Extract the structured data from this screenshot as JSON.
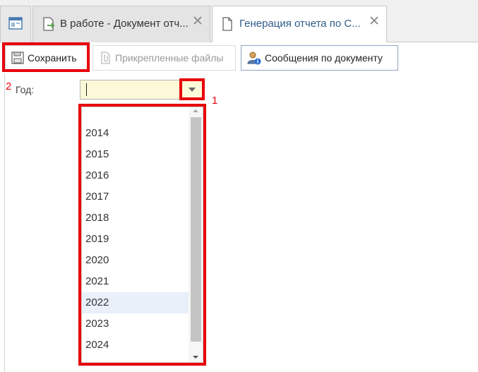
{
  "tabs": [
    {
      "label": "В работе - Документ отч...",
      "icon": "document-arrow-icon",
      "active": false
    },
    {
      "label": "Генерация отчета по С...",
      "icon": "document-icon",
      "active": true
    }
  ],
  "home_tab_icon": "window-icon",
  "toolbar": {
    "save_label": "Сохранить",
    "files_label": "Прикрепленные файлы",
    "messages_label": "Сообщения по документу"
  },
  "form": {
    "year_label": "Год:",
    "year_value": "",
    "year_options": [
      "2014",
      "2015",
      "2016",
      "2017",
      "2018",
      "2019",
      "2020",
      "2021",
      "2022",
      "2023",
      "2024"
    ],
    "hovered_option": "2022"
  },
  "annotations": {
    "callout_1": "1",
    "callout_2": "2",
    "highlight_color": "#e8000b"
  }
}
